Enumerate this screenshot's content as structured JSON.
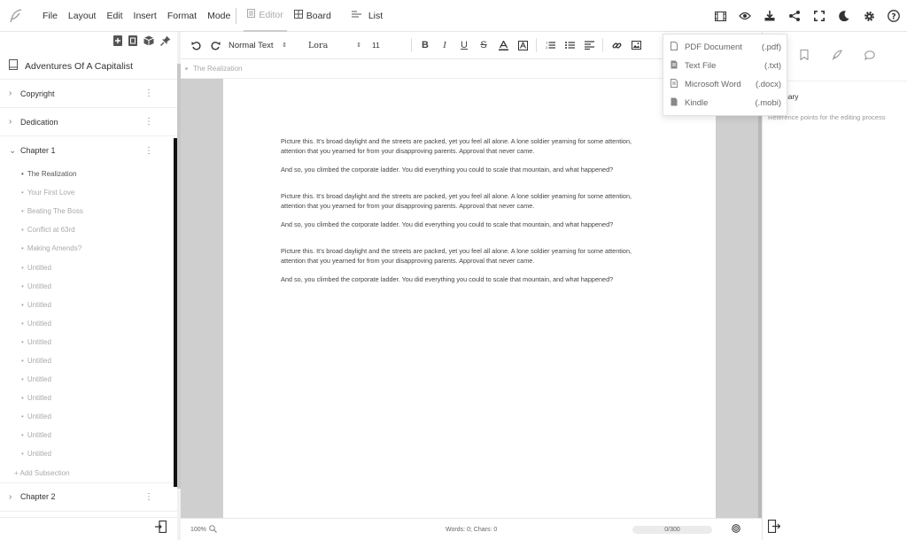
{
  "menu": {
    "items": [
      "File",
      "Layout",
      "Edit",
      "Insert",
      "Format",
      "Mode"
    ],
    "mode_tabs": [
      {
        "label": "Editor",
        "active": true
      },
      {
        "label": "Board",
        "active": false
      },
      {
        "label": "List",
        "active": false
      }
    ]
  },
  "sidebar": {
    "book_title": "Adventures Of A Capitalist",
    "rows_top": [
      {
        "label": "Copyright"
      },
      {
        "label": "Dedication"
      },
      {
        "label": "Chapter 1"
      }
    ],
    "subsections": [
      "The Realization",
      "Your First Love",
      "Beating The Boss",
      "Conflict at 63rd",
      "Making Amends?",
      "Untitled",
      "Untitled",
      "Untitled",
      "Untitled",
      "Untitled",
      "Untitled",
      "Untitled",
      "Untitled",
      "Untitled",
      "Untitled",
      "Untitled"
    ],
    "add_subsection": "+ Add Subsection",
    "rows_bottom": [
      {
        "label": "Chapter 2"
      }
    ]
  },
  "toolbar": {
    "style_select": "Normal Text",
    "font_select": "Lora",
    "size_select": "11"
  },
  "breadcrumb": "The Realization",
  "document": {
    "blocks": [
      {
        "p1": "Picture this. It's broad daylight and the streets are packed, yet you feel all alone. A lone soldier yearning for some attention, attention that you yearned for from your disapproving parents. Approval that never came.",
        "p2": "And so, you climbed the corporate ladder. You did everything you could to scale that mountain, and what happened?"
      },
      {
        "p1": "Picture this. It's broad daylight and the streets are packed, yet you feel all alone. A lone soldier yearning for some attention, attention that you yearned for from your disapproving parents. Approval that never came.",
        "p2": "And so, you climbed the corporate ladder. You did everything you could to scale that mountain, and what happened?"
      },
      {
        "p1": "Picture this. It's broad daylight and the streets are packed, yet you feel all alone. A lone soldier yearning for some attention, attention that you yearned for from your disapproving parents. Approval that never came.",
        "p2": "And so, you climbed the corporate ladder. You did everything you could to scale that mountain, and what happened?"
      }
    ]
  },
  "statusbar": {
    "zoom": "100%",
    "counts": "Words: 0; Chars: 0",
    "goal": "0/300",
    "goal_progress": 0
  },
  "right_panel": {
    "title": "nary",
    "subtitle": "Reference points for the editing process"
  },
  "export_menu": [
    {
      "label": "PDF Document",
      "ext": "(.pdf)"
    },
    {
      "label": "Text File",
      "ext": "(.txt)"
    },
    {
      "label": "Microsoft Word",
      "ext": "(.docx)"
    },
    {
      "label": "Kindle",
      "ext": "(.mobi)"
    }
  ],
  "icons": {
    "logo": "feather-icon",
    "top_right": [
      "film-icon",
      "eye-icon",
      "download-icon",
      "share-icon",
      "fullscreen-icon",
      "moon-icon",
      "gear-icon",
      "help-icon"
    ]
  }
}
